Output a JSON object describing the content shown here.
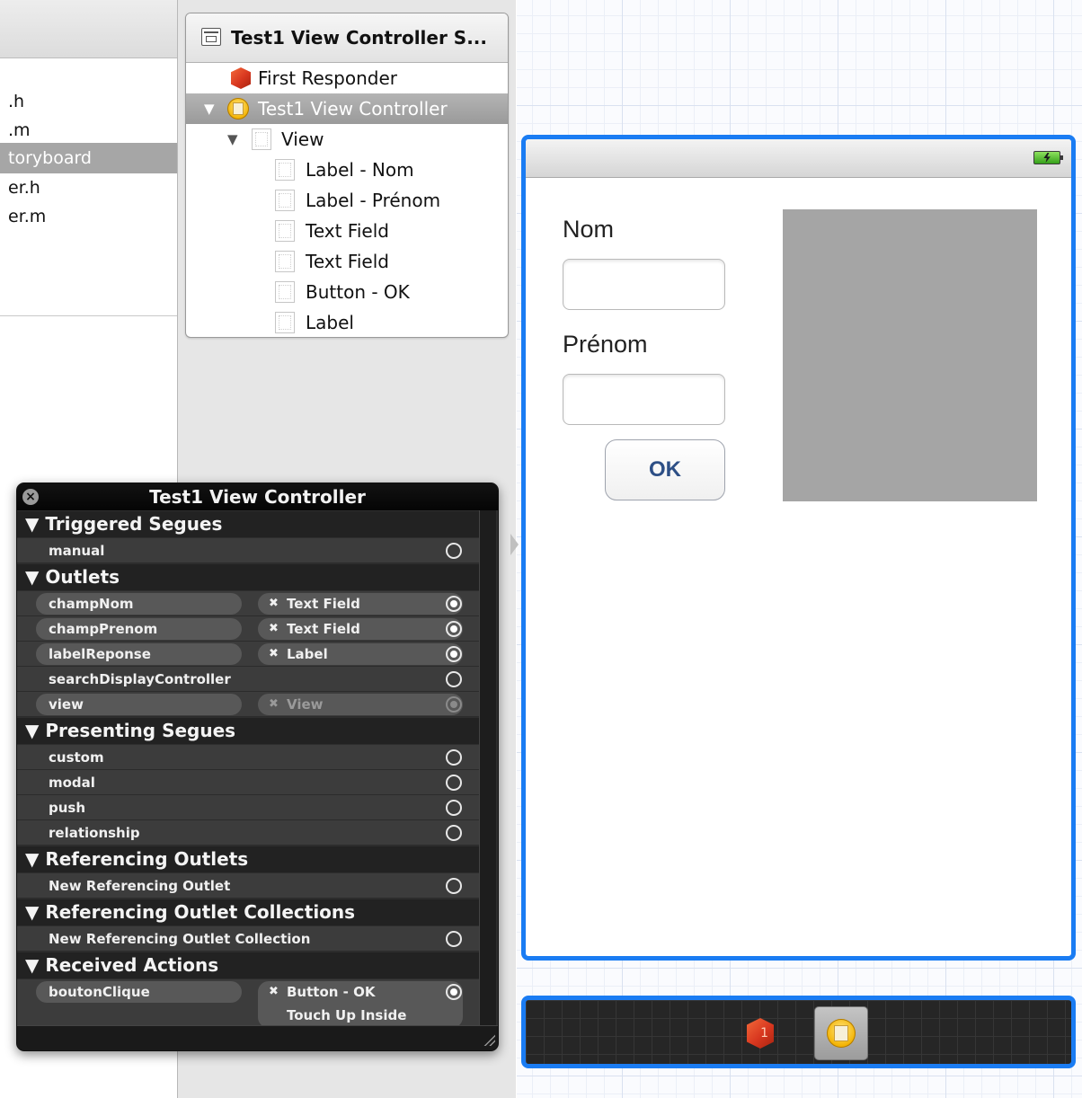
{
  "navigator": {
    "items": [
      {
        "label": ".h",
        "selected": false
      },
      {
        "label": ".m",
        "selected": false
      },
      {
        "label": "toryboard",
        "selected": true
      },
      {
        "label": "er.h",
        "selected": false
      },
      {
        "label": "er.m",
        "selected": false
      }
    ]
  },
  "outline": {
    "title": "Test1 View Controller S...",
    "rows": [
      {
        "label": "First Responder",
        "icon": "cube-icon"
      },
      {
        "label": "Test1 View Controller",
        "icon": "view-controller-icon",
        "selected": true
      },
      {
        "label": "View",
        "icon": "view-icon"
      },
      {
        "label": "Label - Nom",
        "icon": "view-icon"
      },
      {
        "label": "Label - Prénom",
        "icon": "view-icon"
      },
      {
        "label": "Text Field",
        "icon": "view-icon"
      },
      {
        "label": "Text Field",
        "icon": "view-icon"
      },
      {
        "label": "Button - OK",
        "icon": "view-icon"
      },
      {
        "label": "Label",
        "icon": "view-icon"
      }
    ]
  },
  "scene": {
    "label_nom": "Nom",
    "label_prenom": "Prénom",
    "ok_button": "OK",
    "accent_color": "#1a7cf3"
  },
  "dock": {
    "first_responder_badge": "1"
  },
  "hud": {
    "title": "Test1 View Controller",
    "sections": {
      "triggered_segues": "Triggered Segues",
      "outlets": "Outlets",
      "presenting_segues": "Presenting Segues",
      "referencing_outlets": "Referencing Outlets",
      "referencing_outlet_collections": "Referencing Outlet Collections",
      "received_actions": "Received Actions"
    },
    "triggered_segues": [
      {
        "name": "manual"
      }
    ],
    "outlets": [
      {
        "name": "champNom",
        "target": "Text Field"
      },
      {
        "name": "champPrenom",
        "target": "Text Field"
      },
      {
        "name": "labelReponse",
        "target": "Label"
      },
      {
        "name": "searchDisplayController"
      },
      {
        "name": "view",
        "target": "View"
      }
    ],
    "presenting_segues": [
      {
        "name": "custom"
      },
      {
        "name": "modal"
      },
      {
        "name": "push"
      },
      {
        "name": "relationship"
      }
    ],
    "referencing_outlets": [
      {
        "name": "New Referencing Outlet"
      }
    ],
    "referencing_outlet_collections": [
      {
        "name": "New Referencing Outlet Collection"
      }
    ],
    "received_actions": [
      {
        "name": "boutonClique",
        "target": "Button - OK",
        "event": "Touch Up Inside"
      }
    ],
    "remove_mark": "✖",
    "collapse_mark": "▼"
  }
}
